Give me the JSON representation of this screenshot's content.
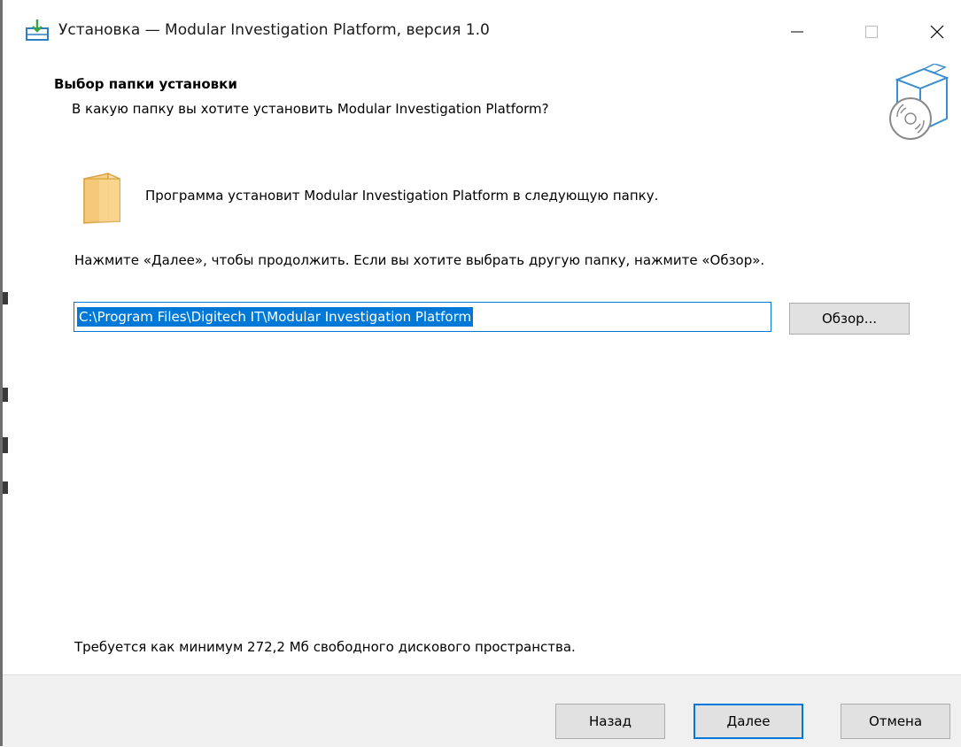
{
  "window": {
    "title": "Установка — Modular Investigation Platform, версия 1.0"
  },
  "header": {
    "title": "Выбор папки установки",
    "subtitle": "В какую папку вы хотите установить Modular Investigation Platform?"
  },
  "body": {
    "info_line": "Программа установит Modular Investigation Platform в следующую папку.",
    "instruction": "Нажмите «Далее», чтобы продолжить. Если вы хотите выбрать другую папку, нажмите «Обзор».",
    "path_value": "C:\\Program Files\\Digitech IT\\Modular Investigation Platform",
    "browse_label": "Обзор...",
    "disk_space": "Требуется как минимум 272,2 Мб свободного дискового пространства."
  },
  "footer": {
    "back_label": "Назад",
    "next_label": "Далее",
    "cancel_label": "Отмена"
  },
  "icons": {
    "app": "installer-icon",
    "box": "software-box-icon",
    "folder": "folder-icon",
    "minimize": "minimize-icon",
    "maximize": "maximize-icon",
    "close": "close-icon"
  },
  "colors": {
    "accent": "#0078d7",
    "footer_bg": "#f0f0f0",
    "button_bg": "#e1e1e1",
    "folder": "#f8d085"
  }
}
